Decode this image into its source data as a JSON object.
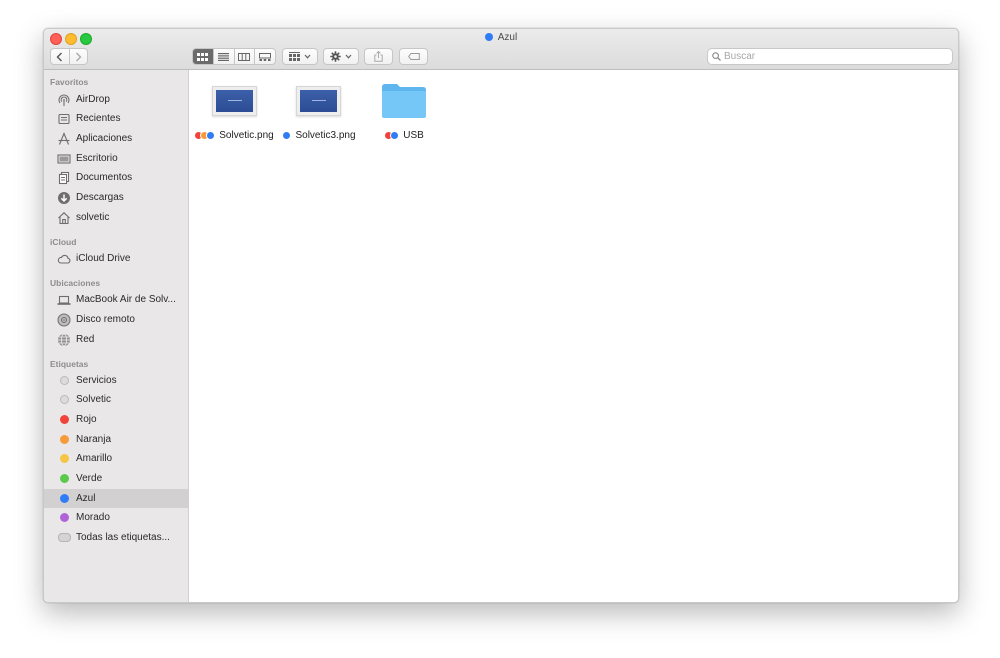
{
  "window": {
    "title": "Azul",
    "title_tag_color": "#2f7cf6"
  },
  "toolbar": {
    "back_icon": "chevron-left-icon",
    "forward_icon": "chevron-right-icon",
    "views": [
      "icon-view",
      "list-view",
      "column-view",
      "gallery-view"
    ],
    "active_view": "icon-view",
    "group_icon": "group-grid-icon",
    "action_icon": "gear-icon",
    "share_icon": "share-icon",
    "tag_icon": "tag-icon"
  },
  "search": {
    "placeholder": "Buscar"
  },
  "sidebar": {
    "favorites_title": "Favoritos",
    "favorites": [
      {
        "label": "AirDrop",
        "icon": "airdrop-icon"
      },
      {
        "label": "Recientes",
        "icon": "recents-icon"
      },
      {
        "label": "Aplicaciones",
        "icon": "applications-icon"
      },
      {
        "label": "Escritorio",
        "icon": "desktop-icon"
      },
      {
        "label": "Documentos",
        "icon": "documents-icon"
      },
      {
        "label": "Descargas",
        "icon": "downloads-icon"
      },
      {
        "label": "solvetic",
        "icon": "home-icon"
      }
    ],
    "icloud_title": "iCloud",
    "icloud": [
      {
        "label": "iCloud Drive",
        "icon": "cloud-icon"
      }
    ],
    "locations_title": "Ubicaciones",
    "locations": [
      {
        "label": "MacBook Air de Solv...",
        "icon": "laptop-icon"
      },
      {
        "label": "Disco remoto",
        "icon": "disc-icon"
      },
      {
        "label": "Red",
        "icon": "network-icon"
      }
    ],
    "tags_title": "Etiquetas",
    "tags": [
      {
        "label": "Servicios",
        "color": "#d9d9d9"
      },
      {
        "label": "Solvetic",
        "color": "#d9d9d9"
      },
      {
        "label": "Rojo",
        "color": "#f0443a"
      },
      {
        "label": "Naranja",
        "color": "#f79a3a"
      },
      {
        "label": "Amarillo",
        "color": "#f6c544"
      },
      {
        "label": "Verde",
        "color": "#5bc94c"
      },
      {
        "label": "Azul",
        "color": "#2f7cf6"
      },
      {
        "label": "Morado",
        "color": "#b063d6"
      },
      {
        "label": "Todas las etiquetas...",
        "color": "#d9d9d9"
      }
    ],
    "selected": "Azul"
  },
  "files": [
    {
      "name": "Solvetic.png",
      "kind": "image",
      "tags": [
        "#f0443a",
        "#f79a3a",
        "#2f7cf6"
      ]
    },
    {
      "name": "Solvetic3.png",
      "kind": "image",
      "tags": [
        "#2f7cf6"
      ]
    },
    {
      "name": "USB",
      "kind": "folder",
      "tags": [
        "#f0443a",
        "#2f7cf6"
      ]
    }
  ]
}
